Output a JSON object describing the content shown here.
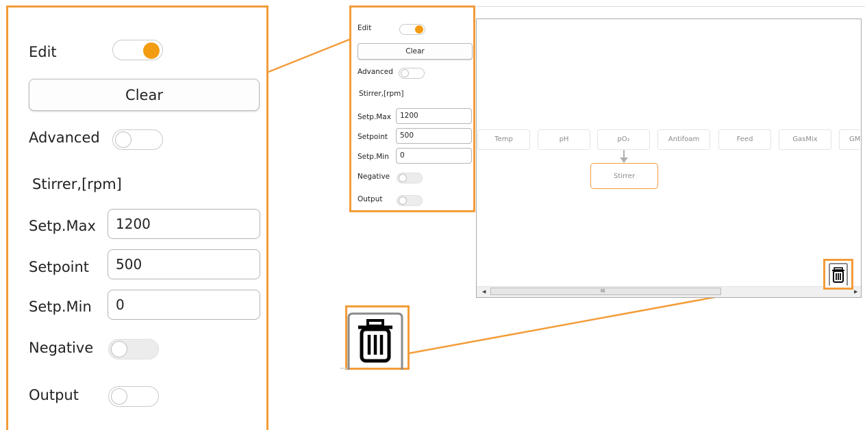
{
  "panel": {
    "edit_label": "Edit",
    "edit_on": true,
    "clear_label": "Clear",
    "advanced_label": "Advanced",
    "section_title": "Stirrer,[rpm]",
    "setp_max_label": "Setp.Max",
    "setp_max_value": "1200",
    "setpoint_label": "Setpoint",
    "setpoint_value": "500",
    "setp_min_label": "Setp.Min",
    "setp_min_value": "0",
    "negative_label": "Negative",
    "output_label": "Output"
  },
  "canvas": {
    "chips": [
      "Temp",
      "pH",
      "pO₂",
      "Antifoam",
      "Feed",
      "GasMix",
      "GM"
    ],
    "node_label": "Stirrer",
    "scrollbar_grip": "III"
  },
  "icons": {
    "trash": "trash-icon",
    "toggle": "toggle-switch"
  },
  "colors": {
    "accent": "#f39c38",
    "toggle_on": "#f39c12"
  }
}
